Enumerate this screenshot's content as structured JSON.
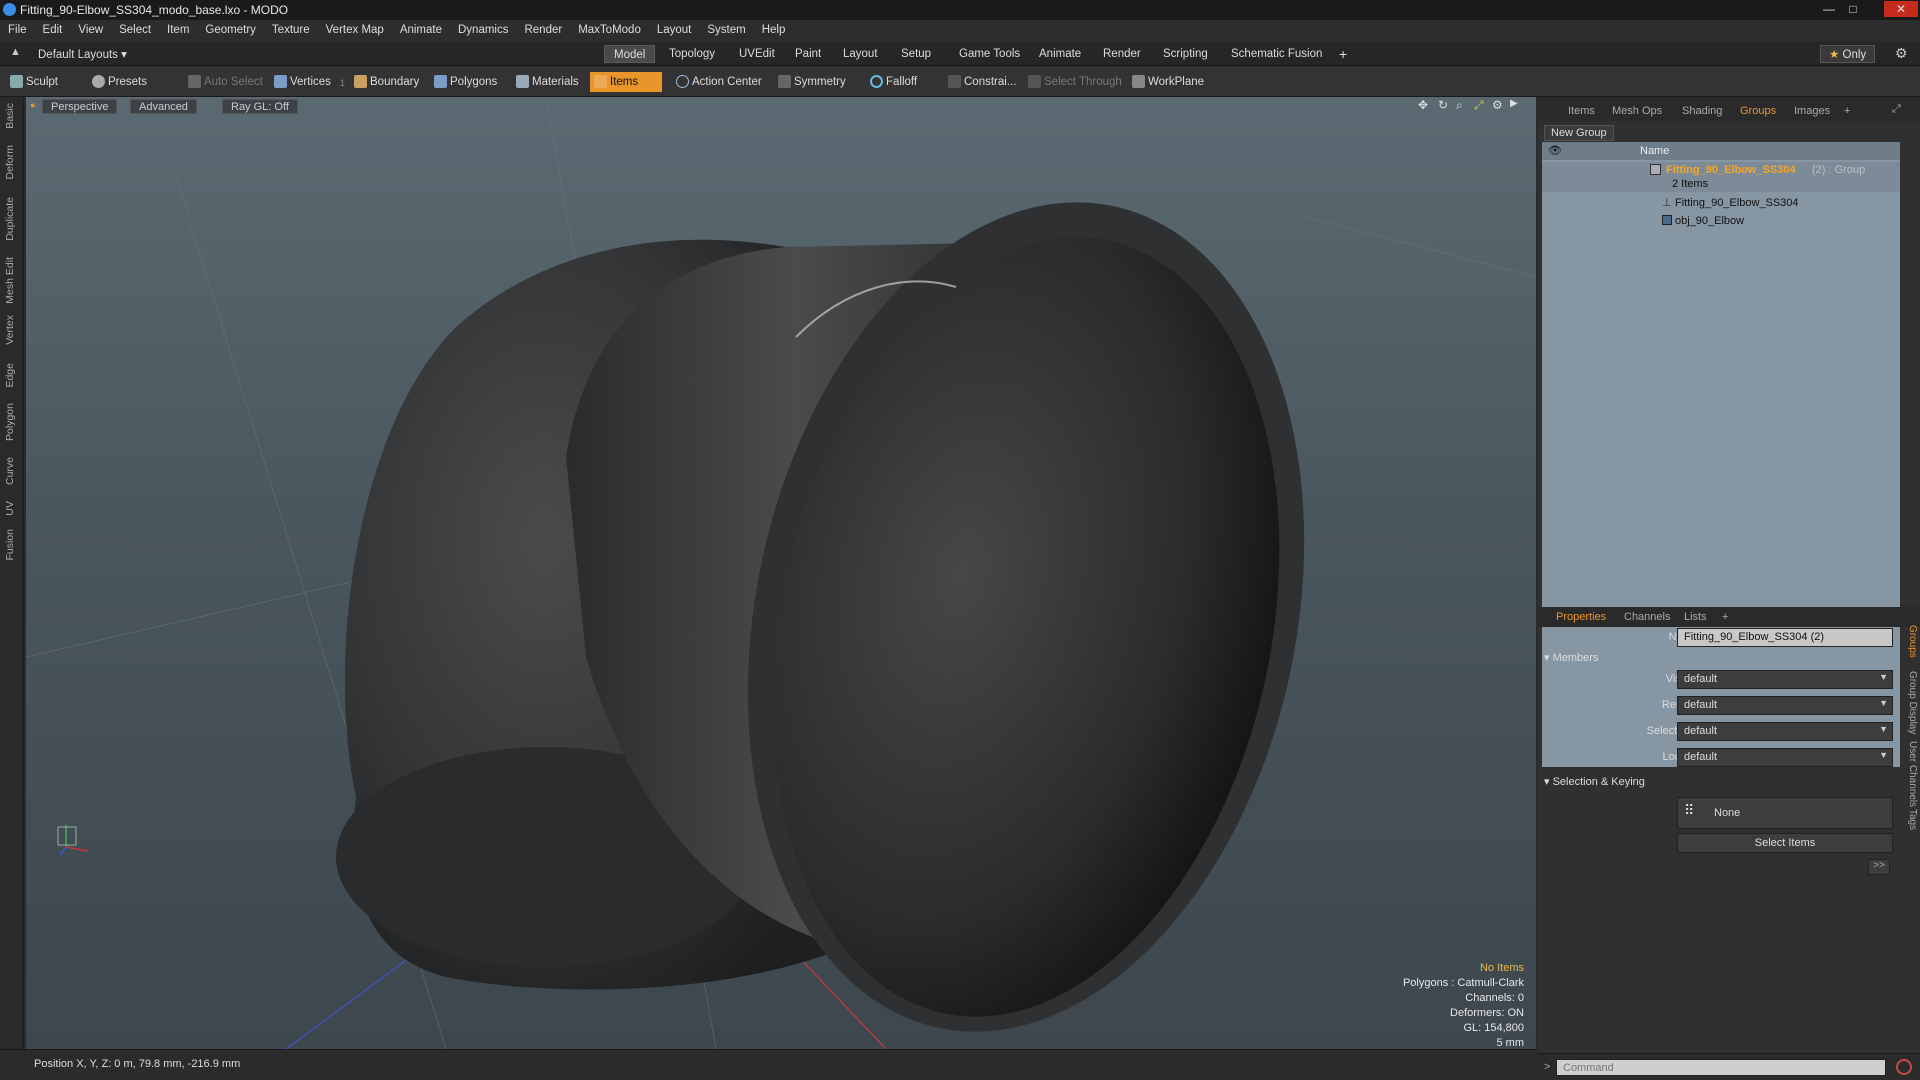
{
  "window": {
    "title": "Fitting_90-Elbow_SS304_modo_base.lxo - MODO"
  },
  "menu": [
    "File",
    "Edit",
    "View",
    "Select",
    "Item",
    "Geometry",
    "Texture",
    "Vertex Map",
    "Animate",
    "Dynamics",
    "Render",
    "MaxToModo",
    "Layout",
    "System",
    "Help"
  ],
  "layoutbar": {
    "preset": "Default Layouts ▾",
    "tabs": [
      "Model",
      "Topology",
      "UVEdit",
      "Paint",
      "Layout",
      "Setup",
      "Game Tools",
      "Animate",
      "Render",
      "Scripting",
      "Schematic Fusion"
    ],
    "active": "Model",
    "add": "+",
    "only": "Only",
    "star": "★"
  },
  "toolbar": {
    "sculpt": "Sculpt",
    "presets": "Presets",
    "auto_select": "Auto Select",
    "vertices": "Vertices",
    "vertices_count": "1",
    "boundary": "Boundary",
    "polygons": "Polygons",
    "materials": "Materials",
    "items": "Items",
    "action_center": "Action Center",
    "symmetry": "Symmetry",
    "falloff": "Falloff",
    "constraints": "Constrai...",
    "select_through": "Select Through",
    "workplane": "WorkPlane"
  },
  "left_tabs": [
    "Basic",
    "Deform",
    "Duplicate",
    "Mesh Edit",
    "Vertex",
    "Edge",
    "Polygon",
    "Curve",
    "UV",
    "Fusion"
  ],
  "viewport": {
    "view": "Perspective",
    "shading": "Advanced",
    "raygl": "Ray GL: Off",
    "hud": {
      "selection": "No Items",
      "polygons": "Polygons : Catmull-Clark",
      "channels": "Channels: 0",
      "deformers": "Deformers: ON",
      "gl": "GL: 154,800",
      "scale": "5 mm"
    }
  },
  "status": {
    "position": "Position X, Y, Z:  0 m, 79.8 mm, -216.9 mm"
  },
  "colors": {
    "accent": "#e8952a",
    "list_bg": "#8796a3"
  },
  "groups_panel": {
    "tabs": [
      "Items",
      "Mesh Ops",
      "Shading",
      "Groups",
      "Images"
    ],
    "active": "Groups",
    "add": "+",
    "new_group": "New Group",
    "name_col": "Name",
    "group_name": "Fitting_90_Elbow_SS304",
    "group_suffix": "(2) : Group",
    "count": "2 Items",
    "children": [
      "Fitting_90_Elbow_SS304",
      "obj_90_Elbow"
    ]
  },
  "properties": {
    "tabs": [
      "Properties",
      "Channels",
      "Lists"
    ],
    "active": "Properties",
    "add": "+",
    "name_label": "Name",
    "name_value": "Fitting_90_Elbow_SS304 (2)",
    "members": "Members",
    "fields": [
      {
        "label": "Visible",
        "value": "default"
      },
      {
        "label": "Render",
        "value": "default"
      },
      {
        "label": "Selectable",
        "value": "default"
      },
      {
        "label": "Locked",
        "value": "default"
      }
    ],
    "selection_keying": "Selection & Keying",
    "none": "None",
    "select_items": "Select Items",
    "more": ">>",
    "side_tabs": [
      "Groups",
      "Group Display",
      "User Channels",
      "Tags"
    ]
  },
  "command": {
    "placeholder": "Command",
    "prompt": ">"
  }
}
